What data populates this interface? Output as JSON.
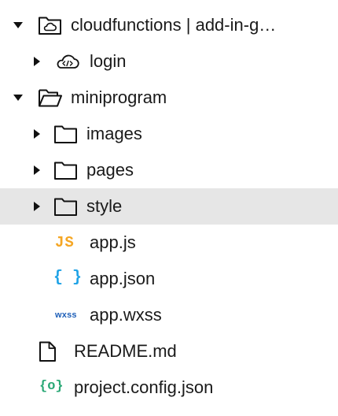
{
  "tree": {
    "cloudfunctions": {
      "label": "cloudfunctions | add-in-g…",
      "expanded": true,
      "icon": "cloud-folder-icon"
    },
    "login": {
      "label": "login",
      "expanded": false,
      "icon": "cloud-code-icon"
    },
    "miniprogram": {
      "label": "miniprogram",
      "expanded": true,
      "icon": "folder-open-icon"
    },
    "images": {
      "label": "images",
      "expanded": false,
      "icon": "folder-icon"
    },
    "pages": {
      "label": "pages",
      "expanded": false,
      "icon": "folder-icon"
    },
    "style": {
      "label": "style",
      "expanded": false,
      "selected": true,
      "icon": "folder-icon"
    },
    "app_js": {
      "label": "app.js",
      "badge": "JS",
      "badge_color": "#f5a623"
    },
    "app_json": {
      "label": "app.json",
      "badge": "{ }",
      "badge_color": "#1ea2e6"
    },
    "app_wxss": {
      "label": "app.wxss",
      "badge": "wxss",
      "badge_color": "#1e5fb8"
    },
    "readme": {
      "label": "README.md",
      "icon": "file-icon"
    },
    "project_config": {
      "label": "project.config.json",
      "badge": "{o}",
      "badge_color": "#2aa876"
    }
  },
  "colors": {
    "selected_row_bg": "#e6e6e6",
    "text": "#1a1a1a"
  }
}
